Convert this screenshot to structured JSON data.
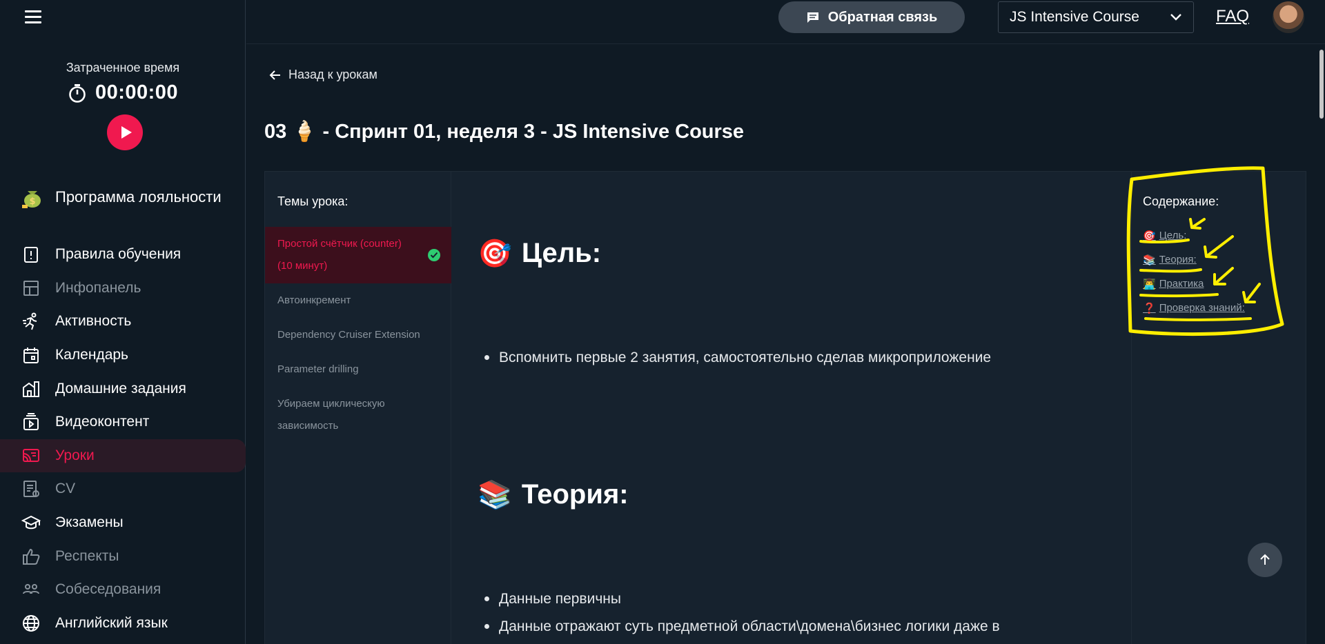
{
  "sidebar": {
    "timer_label": "Затраченное время",
    "timer_value": "00:00:00",
    "loyalty_label": "Программа лояльности",
    "items": [
      {
        "label": "Правила обучения",
        "icon": "alert-doc-icon"
      },
      {
        "label": "Инфопанель",
        "icon": "dashboard-icon"
      },
      {
        "label": "Активность",
        "icon": "running-icon"
      },
      {
        "label": "Календарь",
        "icon": "calendar-icon"
      },
      {
        "label": "Домашние задания",
        "icon": "homework-icon"
      },
      {
        "label": "Видеоконтент",
        "icon": "video-icon"
      },
      {
        "label": "Уроки",
        "icon": "lessons-icon"
      },
      {
        "label": "CV",
        "icon": "cv-icon"
      },
      {
        "label": "Экзамены",
        "icon": "graduation-icon"
      },
      {
        "label": "Респекты",
        "icon": "thumbs-up-icon"
      },
      {
        "label": "Собеседования",
        "icon": "people-icon"
      },
      {
        "label": "Английский язык",
        "icon": "globe-icon"
      }
    ]
  },
  "header": {
    "feedback_label": "Обратная связь",
    "course_selected": "JS Intensive Course",
    "faq_label": "FAQ"
  },
  "main": {
    "back_label": "Назад к урокам",
    "page_title": "03 🍦 - Спринт 01, неделя 3 - JS Intensive Course",
    "topics_title": "Темы урока:",
    "topics": [
      "Простой счётчик (counter) (10 минут)",
      "Автоинкремент",
      "Dependency Cruiser Extension",
      "Parameter drilling",
      "Убираем циклическую зависимость"
    ],
    "sections": [
      {
        "emoji": "🎯",
        "heading": "Цель:",
        "bullets": [
          "Вспомнить первые 2 занятия, самостоятельно сделав микроприложение"
        ]
      },
      {
        "emoji": "📚",
        "heading": "Теория:",
        "bullets": [
          "Данные первичны",
          "Данные отражают суть предметной области\\домена\\бизнес логики даже в"
        ]
      }
    ],
    "toc_title": "Содержание:",
    "toc": [
      {
        "emoji": "🎯",
        "label": "Цель:"
      },
      {
        "emoji": "📚",
        "label": "Теория:"
      },
      {
        "emoji": "👨‍💻",
        "label": "Практика"
      },
      {
        "emoji": "❓",
        "label": "Проверка знаний:"
      }
    ]
  },
  "colors": {
    "accent": "#f0194f",
    "background": "#0f1a24",
    "card": "#16222e",
    "annotation": "#ffee00"
  }
}
